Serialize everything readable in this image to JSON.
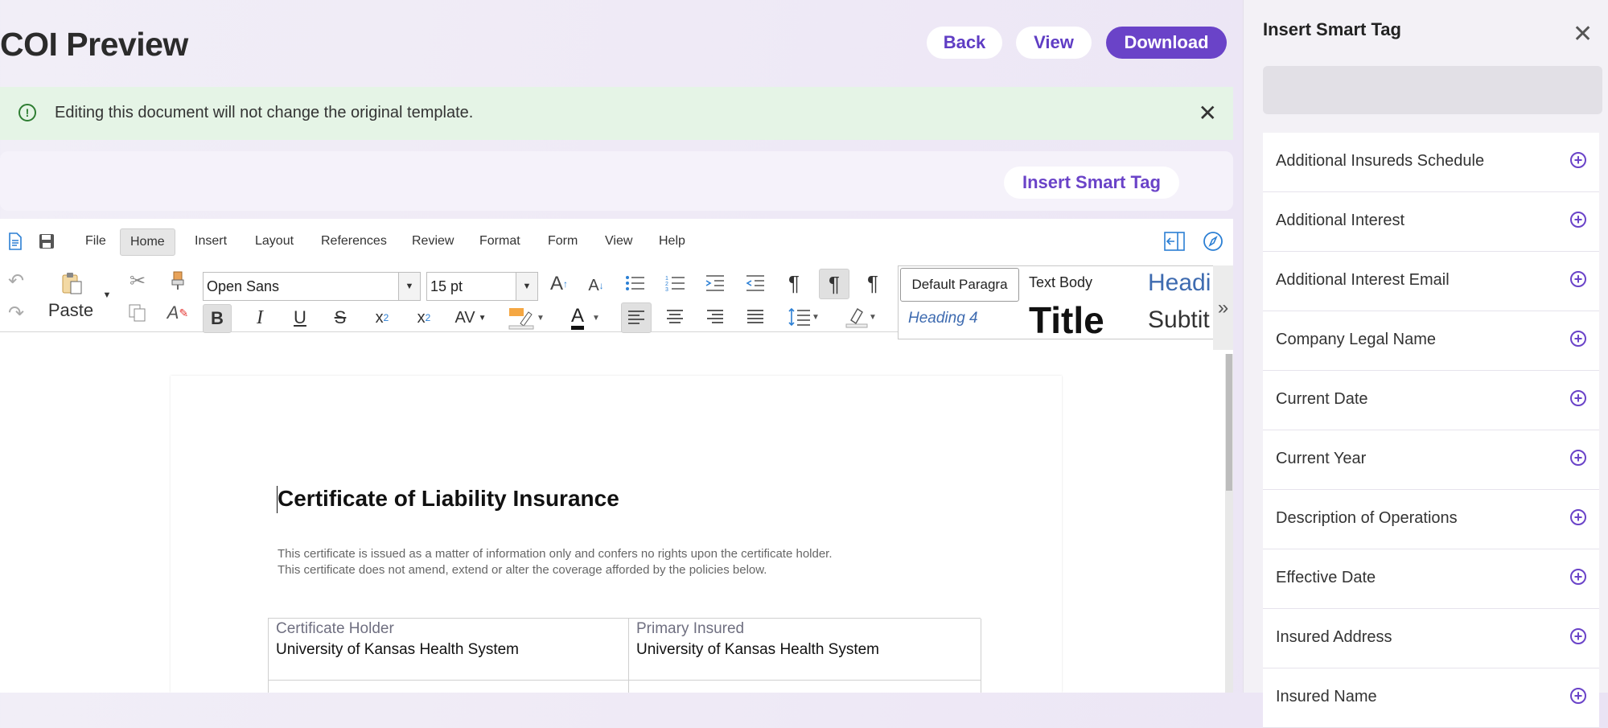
{
  "header": {
    "title": "COI Preview",
    "back_label": "Back",
    "view_label": "View",
    "download_label": "Download"
  },
  "banner": {
    "message": "Editing this document will not change the original template.",
    "close_label": "✕"
  },
  "tag_bar": {
    "insert_label": "Insert Smart Tag"
  },
  "editor": {
    "menu": [
      "File",
      "Home",
      "Insert",
      "Layout",
      "References",
      "Review",
      "Format",
      "Form",
      "View",
      "Help"
    ],
    "active_menu": "Home",
    "paste_label": "Paste",
    "font_name": "Open Sans",
    "font_size": "15 pt",
    "styles": {
      "default_paragraph": "Default Paragra",
      "text_body": "Text Body",
      "heading": "Headi",
      "heading4": "Heading 4",
      "title": "Title",
      "subtitle": "Subtit"
    },
    "ribbon_expand": "»"
  },
  "document": {
    "title": "Certificate of Liability Insurance",
    "disclaimer_1": "This certificate is issued as a matter of information only and confers no rights upon the certificate holder.",
    "disclaimer_2": "This certificate does not amend, extend or alter the coverage afforded by the policies below.",
    "table": {
      "certificate_holder_label": "Certificate Holder",
      "certificate_holder_value": "University of Kansas Health System",
      "primary_insured_label": "Primary Insured",
      "primary_insured_value": "University of Kansas Health System"
    }
  },
  "panel": {
    "title": "Insert Smart Tag",
    "close_label": "✕",
    "search_value": "",
    "items": [
      {
        "label": "Additional Insureds Schedule"
      },
      {
        "label": "Additional Interest"
      },
      {
        "label": "Additional Interest Email"
      },
      {
        "label": "Company Legal Name"
      },
      {
        "label": "Current Date"
      },
      {
        "label": "Current Year"
      },
      {
        "label": "Description of Operations"
      },
      {
        "label": "Effective Date"
      },
      {
        "label": "Insured Address"
      },
      {
        "label": "Insured Name"
      }
    ]
  },
  "colors": {
    "accent": "#6a43c8",
    "banner_bg": "#e5f4e6",
    "banner_icon": "#2e7d32"
  }
}
